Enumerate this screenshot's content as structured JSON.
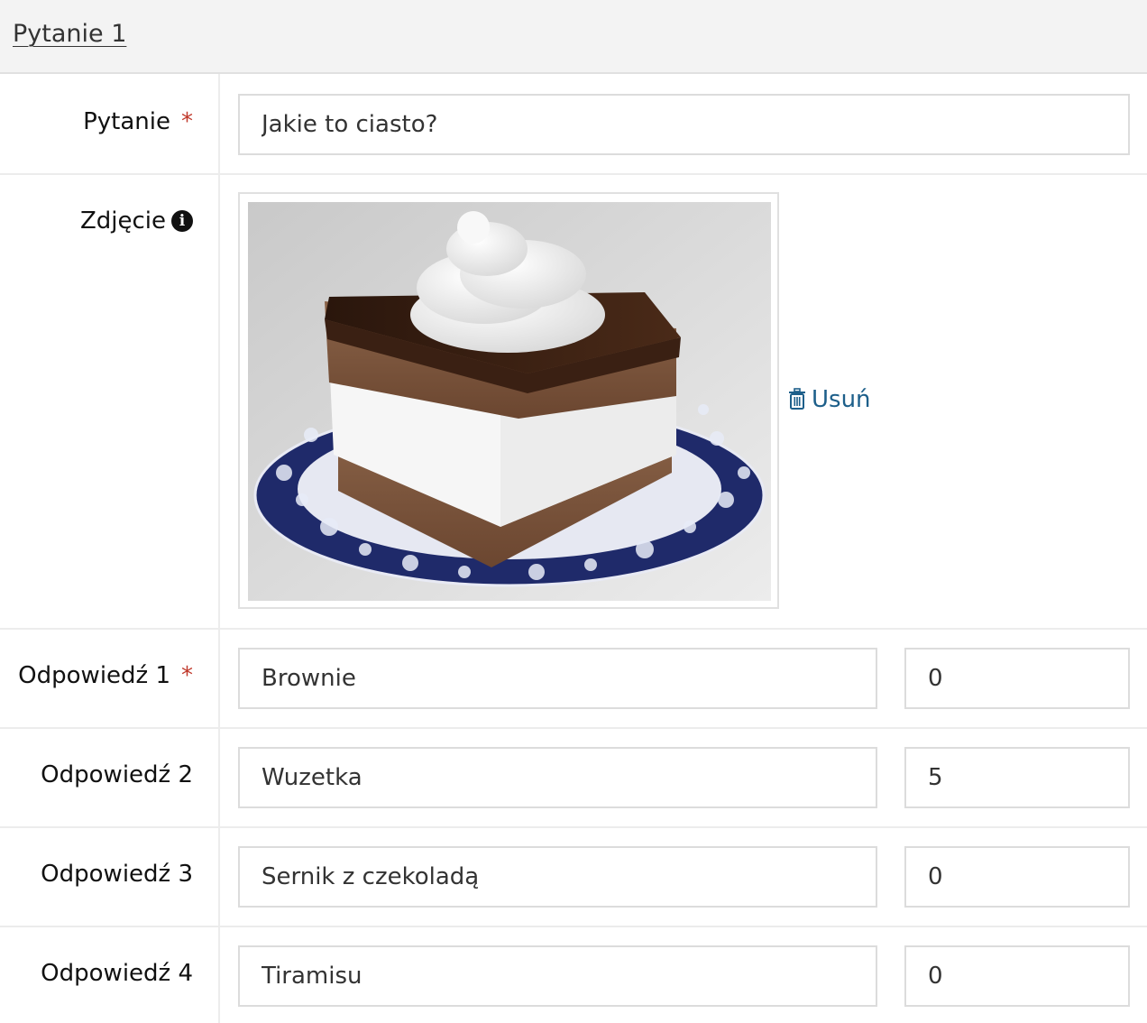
{
  "section": {
    "title": "Pytanie 1"
  },
  "question": {
    "label": "Pytanie",
    "required_mark": "*",
    "value": "Jakie to ciasto?"
  },
  "photo": {
    "label": "Zdjęcie",
    "info_icon": "info-circle-icon",
    "image_alt": "cake-photo",
    "delete_label": "Usuń",
    "delete_icon": "trash-icon"
  },
  "answers": [
    {
      "label": "Odpowiedź 1",
      "required_mark": "*",
      "value": "Brownie",
      "points": "0"
    },
    {
      "label": "Odpowiedź 2",
      "value": "Wuzetka",
      "points": "5"
    },
    {
      "label": "Odpowiedź 3",
      "value": "Sernik z czekoladą",
      "points": "0"
    },
    {
      "label": "Odpowiedź 4",
      "value": "Tiramisu",
      "points": "0"
    }
  ],
  "colors": {
    "link": "#1d5f8a",
    "required": "#c0392b",
    "header_bg": "#f3f3f3"
  }
}
